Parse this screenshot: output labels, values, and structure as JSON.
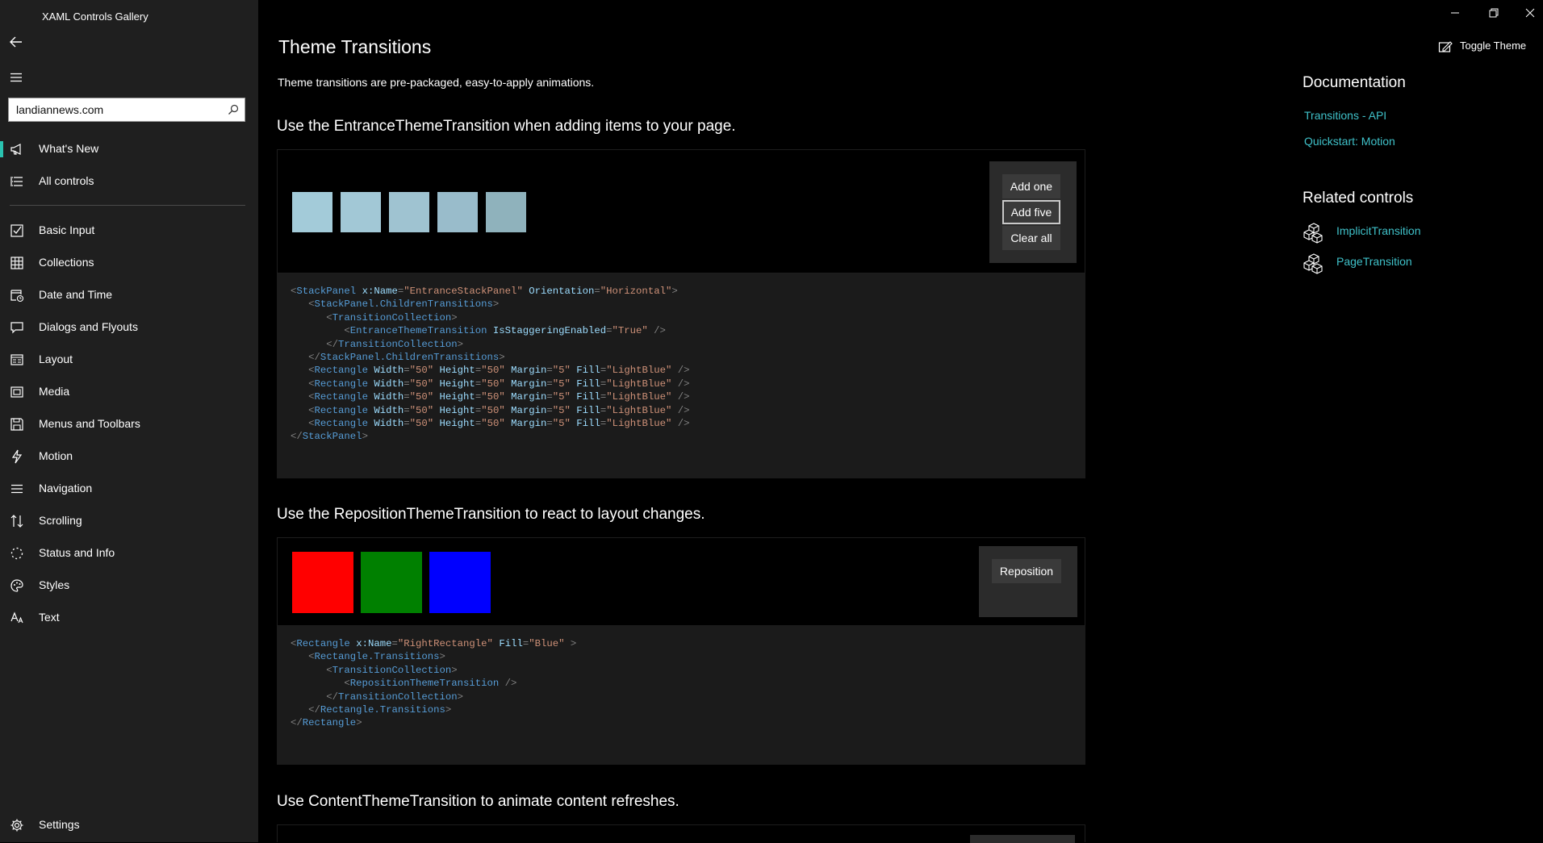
{
  "app": {
    "title": "XAML Controls Gallery"
  },
  "search": {
    "value": "landiannews.com",
    "placeholder": ""
  },
  "nav": {
    "top": [
      {
        "label": "What's New",
        "icon": "megaphone-icon"
      },
      {
        "label": "All controls",
        "icon": "list-icon"
      }
    ],
    "items": [
      {
        "label": "Basic Input",
        "icon": "checkbox-icon"
      },
      {
        "label": "Collections",
        "icon": "grid-icon"
      },
      {
        "label": "Date and Time",
        "icon": "calendar-clock-icon"
      },
      {
        "label": "Dialogs and Flyouts",
        "icon": "message-icon"
      },
      {
        "label": "Layout",
        "icon": "layout-icon"
      },
      {
        "label": "Media",
        "icon": "media-icon"
      },
      {
        "label": "Menus and Toolbars",
        "icon": "save-icon"
      },
      {
        "label": "Motion",
        "icon": "lightning-icon"
      },
      {
        "label": "Navigation",
        "icon": "hamburger-icon"
      },
      {
        "label": "Scrolling",
        "icon": "sort-arrows-icon"
      },
      {
        "label": "Status and Info",
        "icon": "progress-ring-icon"
      },
      {
        "label": "Styles",
        "icon": "palette-icon"
      },
      {
        "label": "Text",
        "icon": "font-icon"
      }
    ],
    "settings": {
      "label": "Settings",
      "icon": "gear-icon"
    }
  },
  "page": {
    "title": "Theme Transitions",
    "description": "Theme transitions are pre-packaged, easy-to-apply animations."
  },
  "toggle_theme": {
    "label": "Toggle Theme"
  },
  "sections": {
    "entrance": {
      "heading": "Use the EntranceThemeTransition when adding items to your page.",
      "buttons": {
        "add_one": "Add one",
        "add_five": "Add five",
        "clear_all": "Clear all"
      },
      "rect_colors": [
        "#a3cbd9",
        "#a2c8d6",
        "#9fc3d1",
        "#99bccb",
        "#8fb2bc"
      ],
      "code": [
        [
          [
            "pn",
            "<"
          ],
          [
            "t",
            "StackPanel"
          ],
          [
            "p",
            " x:Name"
          ],
          [
            "pn",
            "="
          ],
          [
            "v",
            "\"EntranceStackPanel\""
          ],
          [
            "p",
            " Orientation"
          ],
          [
            "pn",
            "="
          ],
          [
            "v",
            "\"Horizontal\""
          ],
          [
            "pn",
            ">"
          ]
        ],
        [
          [
            "pn",
            "   <"
          ],
          [
            "t",
            "StackPanel.ChildrenTransitions"
          ],
          [
            "pn",
            ">"
          ]
        ],
        [
          [
            "pn",
            "      <"
          ],
          [
            "t",
            "TransitionCollection"
          ],
          [
            "pn",
            ">"
          ]
        ],
        [
          [
            "pn",
            "         <"
          ],
          [
            "t",
            "EntranceThemeTransition"
          ],
          [
            "p",
            " IsStaggeringEnabled"
          ],
          [
            "pn",
            "="
          ],
          [
            "v",
            "\"True\""
          ],
          [
            "pn",
            " />"
          ]
        ],
        [
          [
            "pn",
            "      </"
          ],
          [
            "t",
            "TransitionCollection"
          ],
          [
            "pn",
            ">"
          ]
        ],
        [
          [
            "pn",
            "   </"
          ],
          [
            "t",
            "StackPanel.ChildrenTransitions"
          ],
          [
            "pn",
            ">"
          ]
        ],
        [
          [
            "pn",
            "   <"
          ],
          [
            "t",
            "Rectangle"
          ],
          [
            "p",
            " Width"
          ],
          [
            "pn",
            "="
          ],
          [
            "v",
            "\"50\""
          ],
          [
            "p",
            " Height"
          ],
          [
            "pn",
            "="
          ],
          [
            "v",
            "\"50\""
          ],
          [
            "p",
            " Margin"
          ],
          [
            "pn",
            "="
          ],
          [
            "v",
            "\"5\""
          ],
          [
            "p",
            " Fill"
          ],
          [
            "pn",
            "="
          ],
          [
            "v",
            "\"LightBlue\""
          ],
          [
            "pn",
            " />"
          ]
        ],
        [
          [
            "pn",
            "   <"
          ],
          [
            "t",
            "Rectangle"
          ],
          [
            "p",
            " Width"
          ],
          [
            "pn",
            "="
          ],
          [
            "v",
            "\"50\""
          ],
          [
            "p",
            " Height"
          ],
          [
            "pn",
            "="
          ],
          [
            "v",
            "\"50\""
          ],
          [
            "p",
            " Margin"
          ],
          [
            "pn",
            "="
          ],
          [
            "v",
            "\"5\""
          ],
          [
            "p",
            " Fill"
          ],
          [
            "pn",
            "="
          ],
          [
            "v",
            "\"LightBlue\""
          ],
          [
            "pn",
            " />"
          ]
        ],
        [
          [
            "pn",
            "   <"
          ],
          [
            "t",
            "Rectangle"
          ],
          [
            "p",
            " Width"
          ],
          [
            "pn",
            "="
          ],
          [
            "v",
            "\"50\""
          ],
          [
            "p",
            " Height"
          ],
          [
            "pn",
            "="
          ],
          [
            "v",
            "\"50\""
          ],
          [
            "p",
            " Margin"
          ],
          [
            "pn",
            "="
          ],
          [
            "v",
            "\"5\""
          ],
          [
            "p",
            " Fill"
          ],
          [
            "pn",
            "="
          ],
          [
            "v",
            "\"LightBlue\""
          ],
          [
            "pn",
            " />"
          ]
        ],
        [
          [
            "pn",
            "   <"
          ],
          [
            "t",
            "Rectangle"
          ],
          [
            "p",
            " Width"
          ],
          [
            "pn",
            "="
          ],
          [
            "v",
            "\"50\""
          ],
          [
            "p",
            " Height"
          ],
          [
            "pn",
            "="
          ],
          [
            "v",
            "\"50\""
          ],
          [
            "p",
            " Margin"
          ],
          [
            "pn",
            "="
          ],
          [
            "v",
            "\"5\""
          ],
          [
            "p",
            " Fill"
          ],
          [
            "pn",
            "="
          ],
          [
            "v",
            "\"LightBlue\""
          ],
          [
            "pn",
            " />"
          ]
        ],
        [
          [
            "pn",
            "   <"
          ],
          [
            "t",
            "Rectangle"
          ],
          [
            "p",
            " Width"
          ],
          [
            "pn",
            "="
          ],
          [
            "v",
            "\"50\""
          ],
          [
            "p",
            " Height"
          ],
          [
            "pn",
            "="
          ],
          [
            "v",
            "\"50\""
          ],
          [
            "p",
            " Margin"
          ],
          [
            "pn",
            "="
          ],
          [
            "v",
            "\"5\""
          ],
          [
            "p",
            " Fill"
          ],
          [
            "pn",
            "="
          ],
          [
            "v",
            "\"LightBlue\""
          ],
          [
            "pn",
            " />"
          ]
        ],
        [
          [
            "pn",
            "</"
          ],
          [
            "t",
            "StackPanel"
          ],
          [
            "pn",
            ">"
          ]
        ]
      ]
    },
    "reposition": {
      "heading": "Use the RepositionThemeTransition to react to layout changes.",
      "buttons": {
        "reposition": "Reposition"
      },
      "rect_colors": [
        "#ff0000",
        "#008000",
        "#0000ff"
      ],
      "code": [
        [
          [
            "pn",
            "<"
          ],
          [
            "t",
            "Rectangle"
          ],
          [
            "p",
            " x:Name"
          ],
          [
            "pn",
            "="
          ],
          [
            "v",
            "\"RightRectangle\""
          ],
          [
            "p",
            " Fill"
          ],
          [
            "pn",
            "="
          ],
          [
            "v",
            "\"Blue\""
          ],
          [
            "pn",
            " >"
          ]
        ],
        [
          [
            "pn",
            "   <"
          ],
          [
            "t",
            "Rectangle.Transitions"
          ],
          [
            "pn",
            ">"
          ]
        ],
        [
          [
            "pn",
            "      <"
          ],
          [
            "t",
            "TransitionCollection"
          ],
          [
            "pn",
            ">"
          ]
        ],
        [
          [
            "pn",
            "         <"
          ],
          [
            "t",
            "RepositionThemeTransition"
          ],
          [
            "pn",
            " />"
          ]
        ],
        [
          [
            "pn",
            "      </"
          ],
          [
            "t",
            "TransitionCollection"
          ],
          [
            "pn",
            ">"
          ]
        ],
        [
          [
            "pn",
            "   </"
          ],
          [
            "t",
            "Rectangle.Transitions"
          ],
          [
            "pn",
            ">"
          ]
        ],
        [
          [
            "pn",
            "</"
          ],
          [
            "t",
            "Rectangle"
          ],
          [
            "pn",
            ">"
          ]
        ]
      ]
    },
    "content": {
      "heading": "Use ContentThemeTransition to animate content refreshes."
    }
  },
  "documentation": {
    "title": "Documentation",
    "links": [
      "Transitions - API",
      "Quickstart: Motion"
    ]
  },
  "related": {
    "title": "Related controls",
    "links": [
      "ImplicitTransition",
      "PageTransition"
    ]
  },
  "colors": {
    "accent": "#2ac3b0",
    "link": "#3fc1c9",
    "sidebar_bg": "#1f1f1f"
  }
}
